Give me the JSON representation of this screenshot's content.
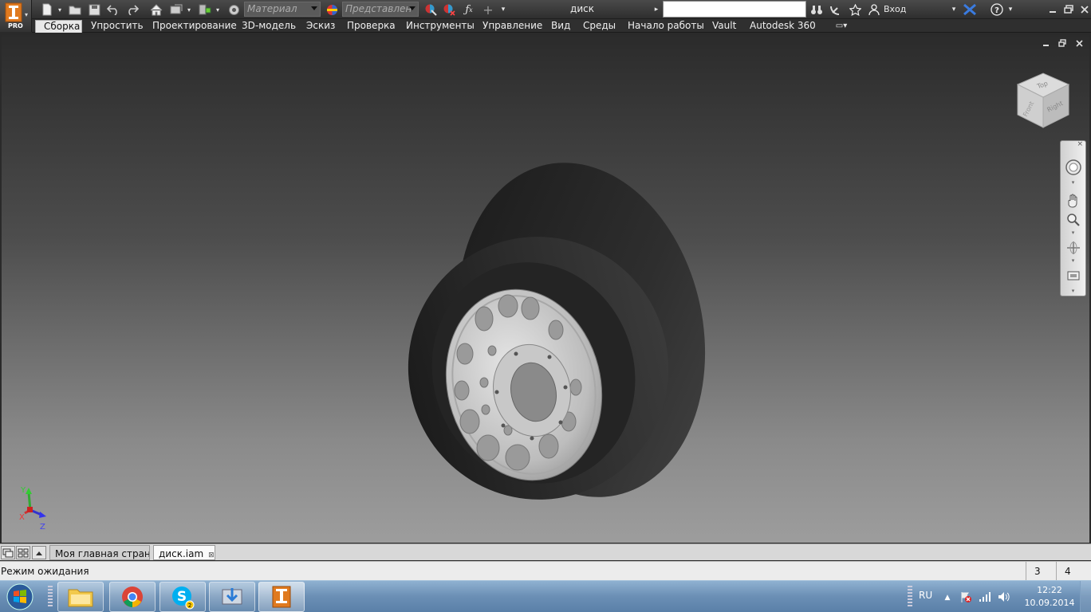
{
  "app": {
    "badge": "PRO"
  },
  "quick_access": {
    "material": "Материал",
    "appearance": "Представлен",
    "document_title": "диск",
    "login": "Вход"
  },
  "ribbon": {
    "tabs": [
      {
        "label": "Сборка"
      },
      {
        "label": "Упростить"
      },
      {
        "label": "Проектирование"
      },
      {
        "label": "3D-модель"
      },
      {
        "label": "Эскиз"
      },
      {
        "label": "Проверка"
      },
      {
        "label": "Инструменты"
      },
      {
        "label": "Управление"
      },
      {
        "label": "Вид"
      },
      {
        "label": "Среды"
      },
      {
        "label": "Начало работы"
      },
      {
        "label": "Vault"
      },
      {
        "label": "Autodesk 360"
      }
    ]
  },
  "viewcube": {
    "top": "Top",
    "front": "Front",
    "right": "Right"
  },
  "triad": {
    "x": "X",
    "y": "Y",
    "z": "Z"
  },
  "doc_tabs": [
    {
      "label": "Моя главная стран..."
    },
    {
      "label": "диск.iam"
    }
  ],
  "status": {
    "text": "Режим ожидания",
    "cell1": "3",
    "cell2": "4"
  },
  "taskbar": {
    "skype_badge": "2",
    "lang": "RU",
    "time": "12:22",
    "date": "10.09.2014"
  }
}
